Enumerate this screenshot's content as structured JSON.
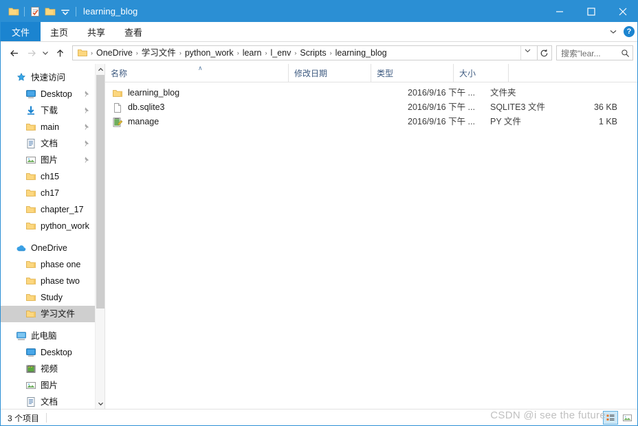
{
  "window": {
    "title": "learning_blog",
    "quick_access_icons": [
      "folder-icon",
      "properties-icon",
      "new-folder-icon",
      "customize-qat-chevron-icon"
    ],
    "controls": {
      "minimize": "—",
      "maximize": "□",
      "close": "✕"
    }
  },
  "ribbon": {
    "tabs": [
      {
        "label": "文件",
        "active": true
      },
      {
        "label": "主页",
        "active": false
      },
      {
        "label": "共享",
        "active": false
      },
      {
        "label": "查看",
        "active": false
      }
    ],
    "collapse_icon": "chevron-down-icon",
    "help_label": "?"
  },
  "address": {
    "back_icon": "arrow-left-icon",
    "forward_icon": "arrow-right-icon",
    "recent_icon": "chevron-down-icon",
    "up_icon": "arrow-up-icon",
    "path_icon": "folder-icon",
    "crumbs": [
      "OneDrive",
      "学习文件",
      "python_work",
      "learn",
      "l_env",
      "Scripts",
      "learning_blog"
    ],
    "separator": "›",
    "dropdown_icon": "chevron-down-icon",
    "refresh_icon": "refresh-icon",
    "search_placeholder": "搜索\"lear...",
    "search_icon": "search-icon"
  },
  "sidebar": {
    "groups": [
      {
        "header": {
          "label": "快速访问",
          "icon": "star-pin-icon"
        },
        "items": [
          {
            "label": "Desktop",
            "icon": "desktop-icon",
            "pinned": true
          },
          {
            "label": "下载",
            "icon": "downloads-icon",
            "pinned": true
          },
          {
            "label": "main",
            "icon": "folder-icon",
            "pinned": true
          },
          {
            "label": "文档",
            "icon": "documents-icon",
            "pinned": true
          },
          {
            "label": "图片",
            "icon": "pictures-icon",
            "pinned": true
          },
          {
            "label": "ch15",
            "icon": "folder-icon",
            "pinned": false
          },
          {
            "label": "ch17",
            "icon": "folder-icon",
            "pinned": false
          },
          {
            "label": "chapter_17",
            "icon": "folder-icon",
            "pinned": false
          },
          {
            "label": "python_work",
            "icon": "folder-icon",
            "pinned": false
          }
        ]
      },
      {
        "header": {
          "label": "OneDrive",
          "icon": "onedrive-cloud-icon"
        },
        "items": [
          {
            "label": "phase one",
            "icon": "folder-icon",
            "pinned": false
          },
          {
            "label": "phase two",
            "icon": "folder-icon",
            "pinned": false
          },
          {
            "label": "Study",
            "icon": "folder-icon",
            "pinned": false
          },
          {
            "label": "学习文件",
            "icon": "folder-icon",
            "pinned": false,
            "selected": true
          }
        ]
      },
      {
        "header": {
          "label": "此电脑",
          "icon": "this-pc-icon"
        },
        "items": [
          {
            "label": "Desktop",
            "icon": "desktop-icon",
            "pinned": false
          },
          {
            "label": "视频",
            "icon": "videos-icon",
            "pinned": false
          },
          {
            "label": "图片",
            "icon": "pictures-icon",
            "pinned": false
          },
          {
            "label": "文档",
            "icon": "documents-icon",
            "pinned": false
          }
        ]
      }
    ],
    "scrollbar": {
      "up_icon": "chevron-up-icon",
      "down_icon": "chevron-down-icon"
    }
  },
  "filelist": {
    "columns": [
      {
        "key": "name",
        "label": "名称",
        "sorted": "asc"
      },
      {
        "key": "date",
        "label": "修改日期"
      },
      {
        "key": "type",
        "label": "类型"
      },
      {
        "key": "size",
        "label": "大小"
      }
    ],
    "sort_caret": "∧",
    "rows": [
      {
        "name": "learning_blog",
        "icon": "folder-icon",
        "date": "2016/9/16 下午 ...",
        "type": "文件夹",
        "size": ""
      },
      {
        "name": "db.sqlite3",
        "icon": "generic-file-icon",
        "date": "2016/9/16 下午 ...",
        "type": "SQLITE3 文件",
        "size": "36 KB"
      },
      {
        "name": "manage",
        "icon": "python-file-icon",
        "date": "2016/9/16 下午 ...",
        "type": "PY 文件",
        "size": "1 KB"
      }
    ]
  },
  "statusbar": {
    "item_count": "3 个项目",
    "views": [
      {
        "name": "details-view",
        "active": true
      },
      {
        "name": "large-icons-view",
        "active": false
      }
    ]
  },
  "watermark": "CSDN @i see the future",
  "colors": {
    "titlebar": "#2b8fd4",
    "accent": "#1b84d0",
    "selection": "#cfcfcf",
    "folder": "#fcd77f",
    "header_text": "#3d5a80"
  }
}
